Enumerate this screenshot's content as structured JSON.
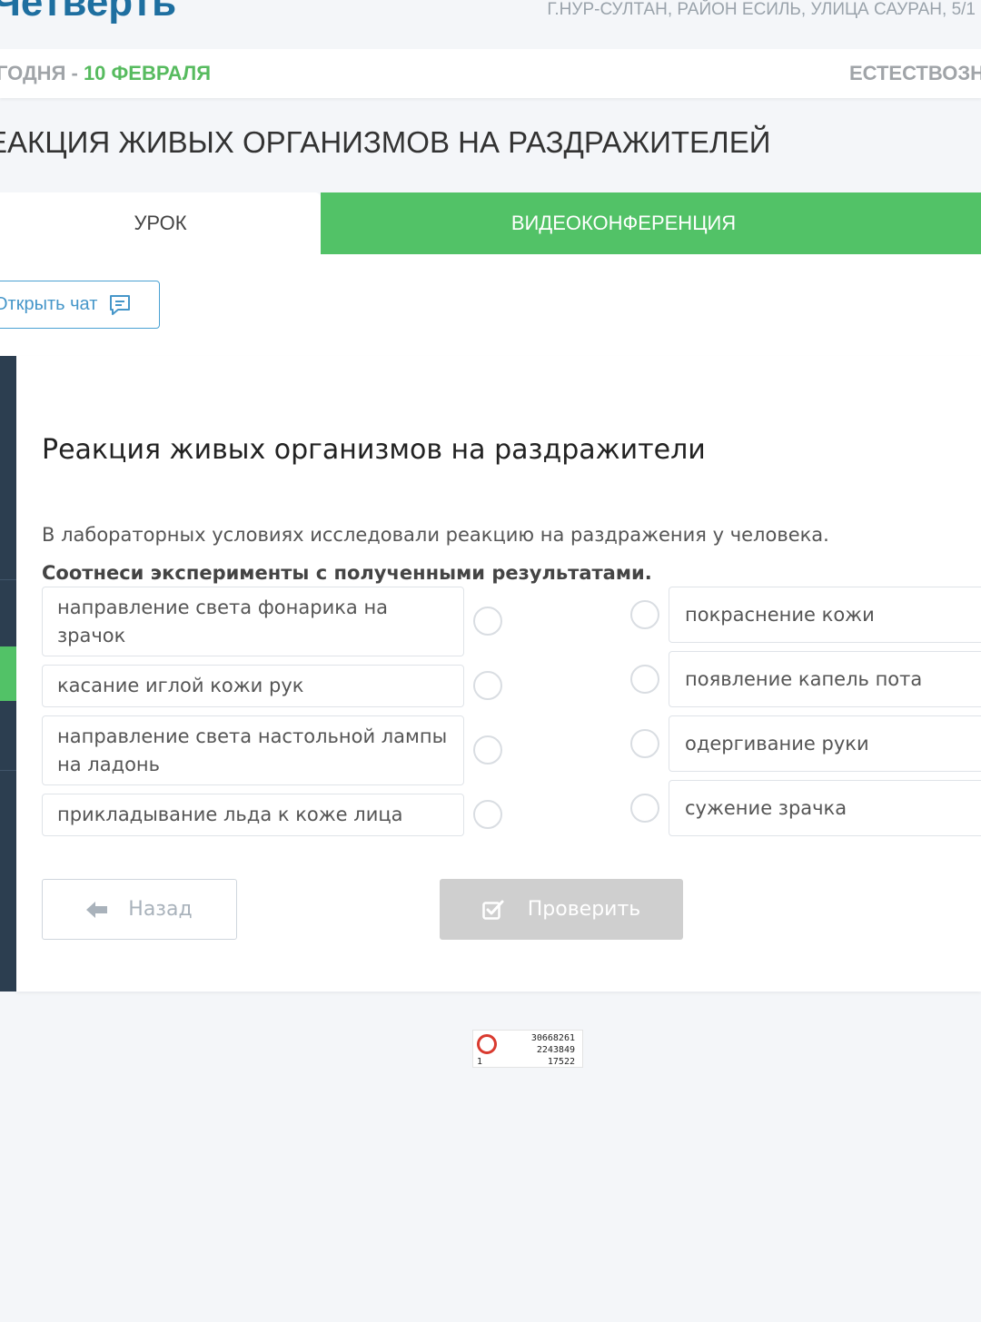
{
  "header": {
    "brand": "Четверть",
    "address": "Г.НУР-СУЛТАН, РАЙОН ЕСИЛЬ, УЛИЦА САУРАН, 5/1",
    "today_prefix": "ГОДНЯ - ",
    "today_date": "10 ФЕВРАЛЯ",
    "subject": "ЕСТЕСТВОЗН"
  },
  "lesson": {
    "title": "ЕАКЦИЯ ЖИВЫХ ОРГАНИЗМОВ НА РАЗДРАЖИТЕЛЕЙ"
  },
  "tabs": {
    "lesson": "УРОК",
    "video": "ВИДЕОКОНФЕРЕНЦИЯ"
  },
  "chat": {
    "label": "Открыть чат",
    "icon": "chat-icon"
  },
  "question": {
    "title": "Реакция живых организмов на раздражители",
    "description": "В лабораторных условиях исследовали реакцию на раздражения у человека.",
    "instruction": "Соотнеси эксперименты с полученными результатами.",
    "left": [
      "направление света фонарика на зрачок",
      "касание иглой кожи рук",
      "направление света настольной лампы на ладонь",
      "прикладывание льда к коже лица"
    ],
    "right": [
      "покраснение кожи",
      "появление капель пота",
      "одергивание руки",
      "сужение зрачка"
    ]
  },
  "buttons": {
    "back": "Назад",
    "check": "Проверить"
  },
  "counter": {
    "line1": "30668261",
    "line2": "2243849",
    "line3": "17522",
    "corner": "1"
  },
  "colors": {
    "brand": "#1e6fa0",
    "accent_green": "#52c267",
    "sidebar": "#2c3e50",
    "disabled": "#cfcfcf"
  }
}
